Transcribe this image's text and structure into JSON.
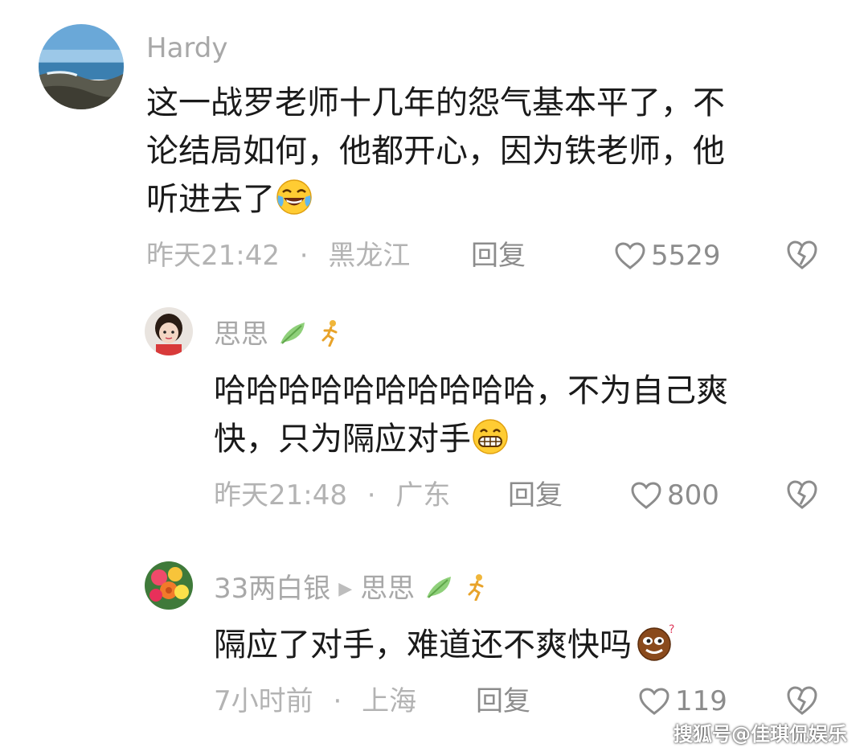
{
  "comments": [
    {
      "username": "Hardy",
      "lines": [
        "这一战罗老师十几年的怨气基本平了，不",
        "论结局如何，他都开心，因为铁老师，他",
        "听进去了"
      ],
      "emoji": "laugh-crying-emoji",
      "time": "昨天21:42",
      "separator": "·",
      "location": "黑龙江",
      "reply_label": "回复",
      "likes": "5529"
    },
    {
      "username": "思思",
      "lines": [
        "哈哈哈哈哈哈哈哈哈哈，不为自己爽",
        "快，只为隔应对手"
      ],
      "emoji": "grin-emoji",
      "time": "昨天21:48",
      "separator": "·",
      "location": "广东",
      "reply_label": "回复",
      "likes": "800"
    },
    {
      "username": "33两白银",
      "reply_to": "思思",
      "lines": [
        "隔应了对手，难道还不爽快吗"
      ],
      "emoji": "smug-emoji",
      "time": "7小时前",
      "separator": "·",
      "location": "上海",
      "reply_label": "回复",
      "likes": "119"
    }
  ],
  "watermark": "搜狐号@佳琪侃娱乐",
  "colors": {
    "username": "#a8a8a8",
    "body_text": "#1a1a1a",
    "meta": "#b3b3b3",
    "action": "#8c8c8c"
  }
}
